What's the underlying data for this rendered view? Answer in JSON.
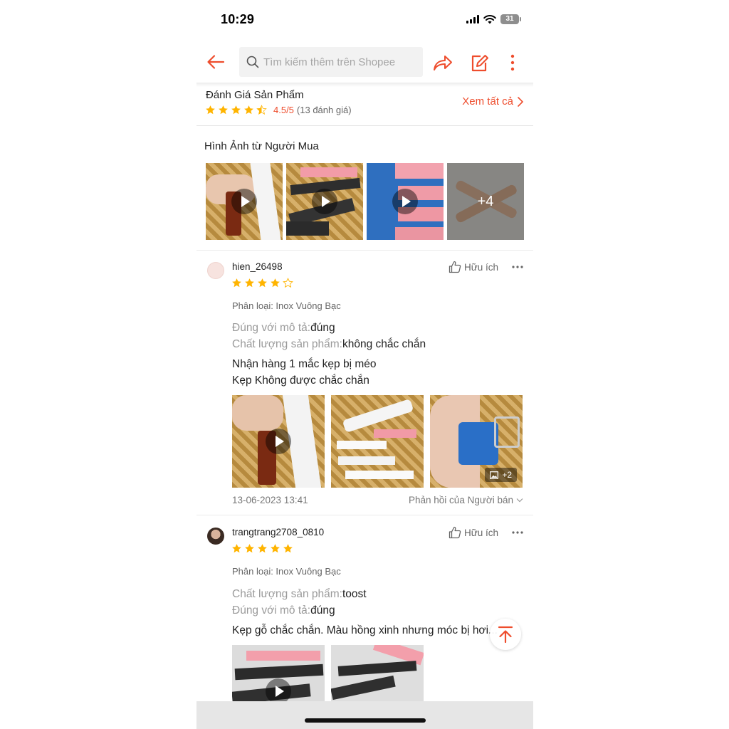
{
  "status_bar": {
    "time": "10:29",
    "battery": "31"
  },
  "header": {
    "search_placeholder": "Tìm kiếm thêm trên Shopee",
    "back_icon": "arrow-left-icon",
    "share_icon": "share-icon",
    "edit_icon": "edit-icon",
    "more_icon": "more-vertical-icon",
    "accent_color": "#ee4d2d"
  },
  "rating_summary": {
    "title": "Đánh Giá Sản Phẩm",
    "rating": 4.5,
    "score_text": "4.5/5",
    "count_text": "(13 đánh giá)",
    "see_all": "Xem tất cả",
    "star_color": "#ffb400"
  },
  "buyer_images": {
    "title": "Hình Ảnh từ Người Mua",
    "more_count": "+4",
    "thumbnails": [
      {
        "type": "video"
      },
      {
        "type": "video"
      },
      {
        "type": "video"
      },
      {
        "type": "image"
      }
    ]
  },
  "reviews": [
    {
      "username": "hien_26498",
      "stars": 4,
      "helpful": "Hữu ích",
      "variation": "Phân loại: Inox Vuông Bạc",
      "attributes": [
        {
          "key": "Đúng với mô tả:",
          "value": "đúng"
        },
        {
          "key": "Chất lượng sản phẩm:",
          "value": "không chắc chắn"
        }
      ],
      "comment": [
        "Nhận hàng 1 mắc kẹp  bị méo",
        "Kẹp Không được chắc chắn"
      ],
      "media_more": "+2",
      "date": "13-06-2023 13:41",
      "seller_reply": "Phản hồi của Người bán"
    },
    {
      "username": "trangtrang2708_0810",
      "stars": 5,
      "helpful": "Hữu ích",
      "variation": "Phân loại: Inox Vuông Bạc",
      "attributes": [
        {
          "key": "Chất lượng sản phẩm:",
          "value": "toost"
        },
        {
          "key": "Đúng với mô tả:",
          "value": "đúng"
        }
      ],
      "comment": [
        "Kẹp gỗ chắc chắn. Màu hồng xinh nhưng móc bị hơi..."
      ]
    }
  ]
}
